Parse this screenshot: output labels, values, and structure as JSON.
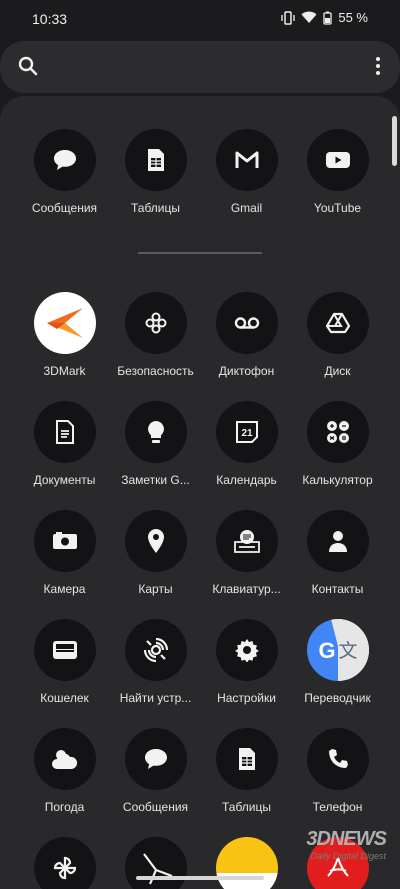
{
  "status_bar": {
    "time": "10:33",
    "battery": "55 %"
  },
  "search": {
    "placeholder": ""
  },
  "rows": [
    [
      {
        "label": "Сообщения",
        "icon": "chat-bubble-icon"
      },
      {
        "label": "Таблицы",
        "icon": "sheets-icon"
      },
      {
        "label": "Gmail",
        "icon": "gmail-icon"
      },
      {
        "label": "YouTube",
        "icon": "youtube-icon"
      }
    ],
    [
      {
        "label": "3DMark",
        "icon": "3dmark-icon"
      },
      {
        "label": "Безопасность",
        "icon": "security-icon"
      },
      {
        "label": "Диктофон",
        "icon": "voicemail-icon"
      },
      {
        "label": "Диск",
        "icon": "drive-icon"
      }
    ],
    [
      {
        "label": "Документы",
        "icon": "docs-icon"
      },
      {
        "label": "Заметки G...",
        "icon": "lightbulb-icon"
      },
      {
        "label": "Календарь",
        "icon": "calendar-icon"
      },
      {
        "label": "Калькулятор",
        "icon": "calculator-icon"
      }
    ],
    [
      {
        "label": "Камера",
        "icon": "camera-icon"
      },
      {
        "label": "Карты",
        "icon": "map-pin-icon"
      },
      {
        "label": "Клавиатур...",
        "icon": "keyboard-icon"
      },
      {
        "label": "Контакты",
        "icon": "contacts-icon"
      }
    ],
    [
      {
        "label": "Кошелек",
        "icon": "wallet-icon"
      },
      {
        "label": "Найти устр...",
        "icon": "find-device-icon"
      },
      {
        "label": "Настройки",
        "icon": "gear-icon"
      },
      {
        "label": "Переводчик",
        "icon": "translate-icon"
      }
    ],
    [
      {
        "label": "Погода",
        "icon": "weather-icon"
      },
      {
        "label": "Сообщения",
        "icon": "chat-bubble-icon"
      },
      {
        "label": "Таблицы",
        "icon": "sheets-icon"
      },
      {
        "label": "Телефон",
        "icon": "phone-icon"
      }
    ]
  ],
  "watermark": {
    "brand": "3DNEWS",
    "tagline": "Daily Digital Digest"
  }
}
